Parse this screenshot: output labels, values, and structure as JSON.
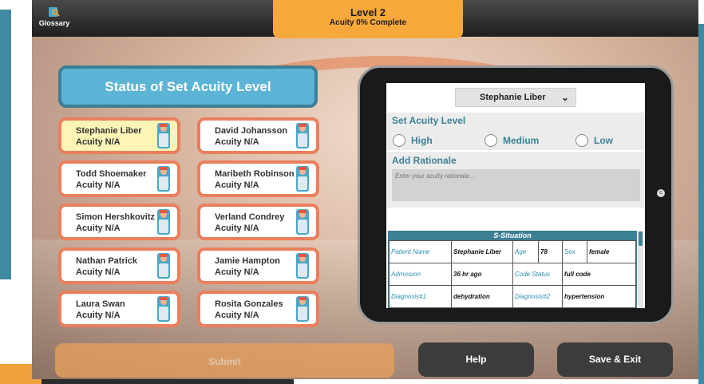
{
  "header": {
    "glossary_label": "Glossary",
    "level_title": "Level 2",
    "level_progress": "Acuity 0% Complete"
  },
  "status_title": "Status of Set Acuity Level",
  "patients": [
    {
      "name": "Stephanie Liber",
      "acuity": "Acuity N/A"
    },
    {
      "name": "David Johansson",
      "acuity": "Acuity N/A"
    },
    {
      "name": "Todd Shoemaker",
      "acuity": "Acuity N/A"
    },
    {
      "name": "Maribeth Robinson",
      "acuity": "Acuity N/A"
    },
    {
      "name": "Simon Hershkovitz",
      "acuity": "Acuity N/A"
    },
    {
      "name": "Verland Condrey",
      "acuity": "Acuity N/A"
    },
    {
      "name": "Nathan Patrick",
      "acuity": "Acuity N/A"
    },
    {
      "name": "Jamie Hampton",
      "acuity": "Acuity N/A"
    },
    {
      "name": "Laura Swan",
      "acuity": "Acuity N/A"
    },
    {
      "name": "Rosita Gonzales",
      "acuity": "Acuity N/A"
    }
  ],
  "selected_patient": "Stephanie Liber",
  "tablet": {
    "patient_dropdown": "Stephanie Liber",
    "acuity_heading": "Set Acuity Level",
    "options": [
      "High",
      "Medium",
      "Low"
    ],
    "rationale_heading": "Add Rationale",
    "rationale_placeholder": "Enter your acuity rationale...",
    "sbar_heading": "S-Situation",
    "sbar_rows": [
      [
        "Patient Name",
        "Stephanie Liber",
        "Age",
        "78",
        "Sex",
        "female"
      ],
      [
        "Admission",
        "36 hr ago",
        "Code Status",
        "full code"
      ],
      [
        "Diagnosis#1",
        "dehydration",
        "Diagnosis#2",
        "hypertension"
      ]
    ]
  },
  "buttons": {
    "submit": "Submit",
    "help": "Help",
    "save_exit": "Save & Exit"
  },
  "colors": {
    "accent_blue": "#5bb4d6",
    "card_border": "#ea7f5e",
    "level_tab": "#f7a83a",
    "selected_card": "#fdf4b6"
  }
}
